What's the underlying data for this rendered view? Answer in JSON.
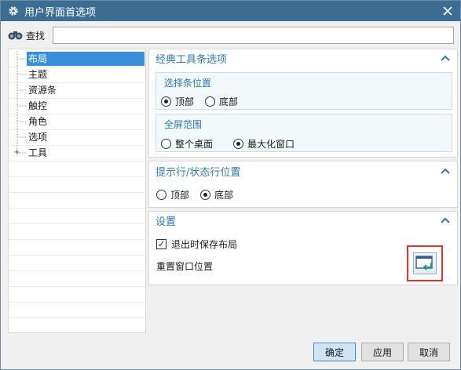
{
  "window": {
    "title": "用户界面首选项"
  },
  "search": {
    "label": "查找",
    "value": "",
    "placeholder": ""
  },
  "tree": {
    "items": [
      {
        "label": "布局",
        "selected": true,
        "expandable": false
      },
      {
        "label": "主题",
        "selected": false,
        "expandable": false
      },
      {
        "label": "资源条",
        "selected": false,
        "expandable": false
      },
      {
        "label": "触控",
        "selected": false,
        "expandable": false
      },
      {
        "label": "角色",
        "selected": false,
        "expandable": false
      },
      {
        "label": "选项",
        "selected": false,
        "expandable": false
      },
      {
        "label": "工具",
        "selected": false,
        "expandable": true
      }
    ]
  },
  "classic_toolbar": {
    "header": "经典工具条选项",
    "selection_position": {
      "title": "选择条位置",
      "options": [
        "顶部",
        "底部"
      ],
      "selected": "顶部"
    },
    "fullscreen_range": {
      "title": "全屏范围",
      "options": [
        "整个桌面",
        "最大化窗口"
      ],
      "selected": "最大化窗口"
    }
  },
  "prompt_status": {
    "header": "提示行/状态行位置",
    "options": [
      "顶部",
      "底部"
    ],
    "selected": "底部"
  },
  "settings": {
    "header": "设置",
    "save_layout_on_exit": {
      "label": "退出时保存布局",
      "checked": true
    },
    "reset_window_label": "重置窗口位置"
  },
  "buttons": {
    "ok": "确定",
    "apply": "应用",
    "cancel": "取消"
  },
  "colors": {
    "titlebar": "#3c6e93",
    "accent": "#2e78b8",
    "selection": "#3b8fd9",
    "highlight_box": "#e8302a"
  }
}
